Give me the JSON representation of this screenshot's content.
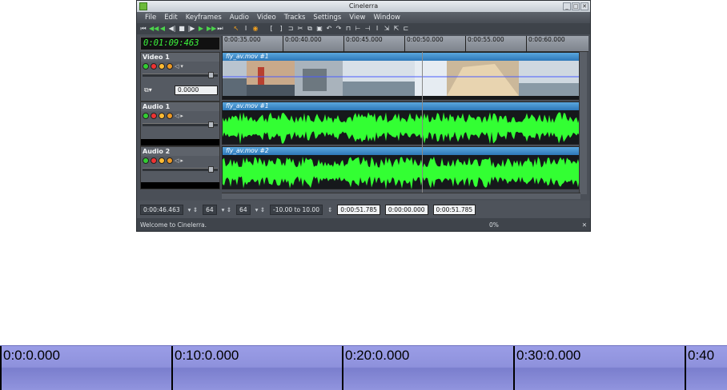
{
  "window": {
    "title": "Cinelerra",
    "controls": [
      "_",
      "□",
      "✕"
    ]
  },
  "menu": [
    "File",
    "Edit",
    "Keyframes",
    "Audio",
    "Video",
    "Tracks",
    "Settings",
    "View",
    "Window"
  ],
  "clock": "0:01:09:463",
  "ruler": [
    "0:00:35.000",
    "0:00:40.000",
    "0:00:45.000",
    "0:00:50.000",
    "0:00:55.000",
    "0:00:60.000"
  ],
  "tracks": [
    {
      "name": "Video 1",
      "clip": "fly_av.mov #1",
      "fade": "0.0000"
    },
    {
      "name": "Audio 1",
      "clip": "fly_av.mov #1"
    },
    {
      "name": "Audio 2",
      "clip": "fly_av.mov #2"
    }
  ],
  "bottombar": {
    "position": "0:00:46.463",
    "zoom_samples": "64",
    "zoom_amp": "64",
    "range": "-10.00 to 10.00",
    "sel_start": "0:00:51.785",
    "sel_len": "0:00:00.000",
    "sel_end": "0:00:51.785"
  },
  "status": {
    "message": "Welcome to Cinelerra.",
    "progress": "0%"
  },
  "big_ruler": [
    "0:0:0.000",
    "0:10:0.000",
    "0:20:0.000",
    "0:30:0.000",
    "0:40"
  ],
  "colors": {
    "waveform": "#33ff33",
    "clip_label": "#3a87c8",
    "ruler_big": "#9194de"
  }
}
